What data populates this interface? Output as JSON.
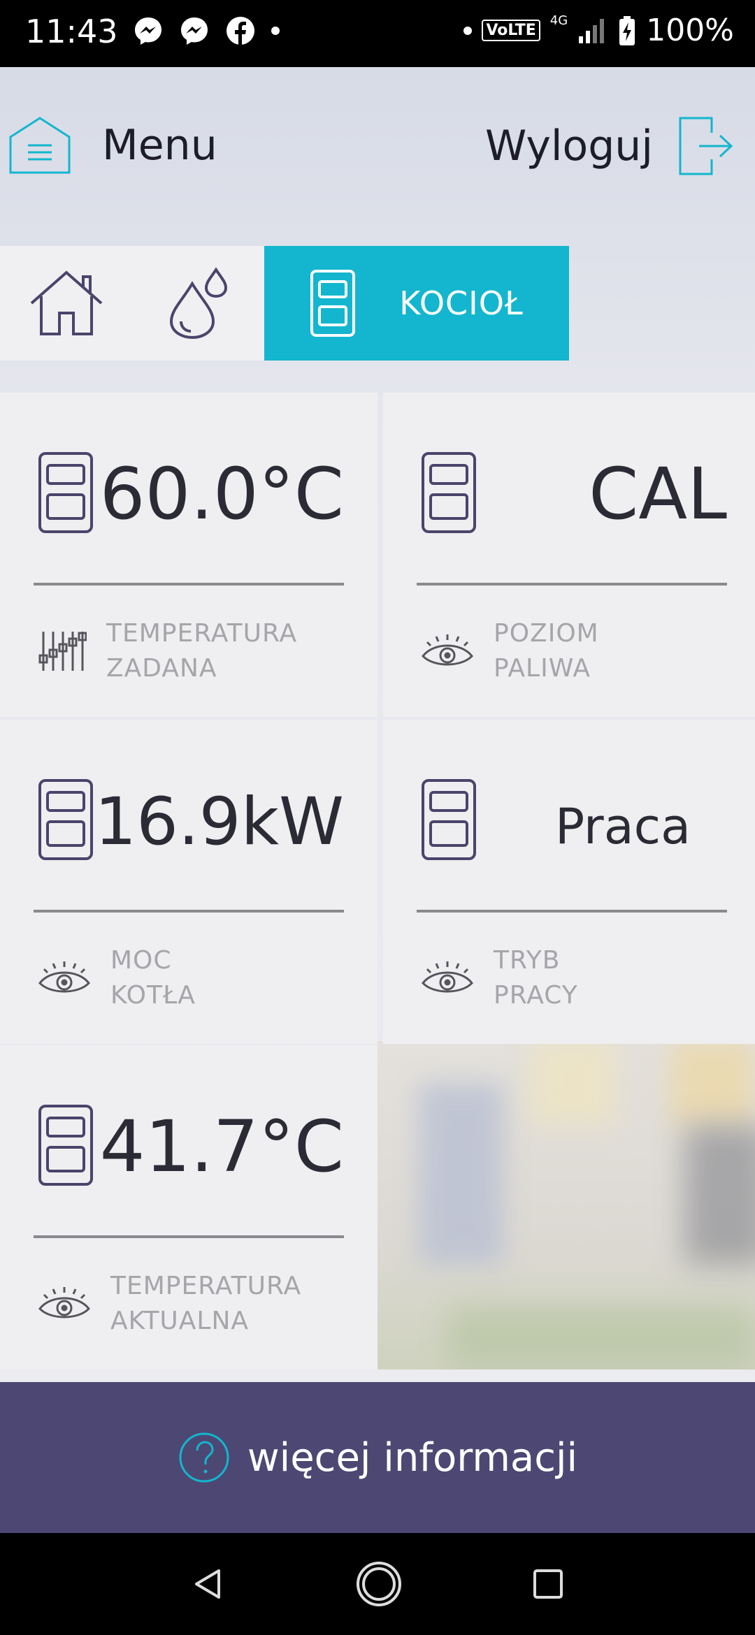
{
  "status_bar": {
    "time": "11:43",
    "left_icons": [
      "messenger-icon",
      "messenger-icon",
      "facebook-icon",
      "dot-icon"
    ],
    "volte": "VoLTE",
    "network": "4G",
    "battery": "100%"
  },
  "header": {
    "menu_label": "Menu",
    "logout_label": "Wyloguj"
  },
  "tabs": [
    {
      "icon": "home-icon",
      "label": "",
      "active": false
    },
    {
      "icon": "water-drops-icon",
      "label": "",
      "active": false
    },
    {
      "icon": "boiler-icon",
      "label": "KOCIOŁ",
      "active": true
    }
  ],
  "cards": [
    {
      "value": "60.0°C",
      "label_line1": "TEMPERATURA",
      "label_line2": "ZADANA",
      "label_icon": "sliders-icon"
    },
    {
      "value": "CAL",
      "label_line1": "POZIOM",
      "label_line2": "PALIWA",
      "label_icon": "eye-icon"
    },
    {
      "value": "16.9kW",
      "label_line1": "MOC",
      "label_line2": "KOTŁA",
      "label_icon": "eye-icon"
    },
    {
      "value": "Praca",
      "label_line1": "TRYB",
      "label_line2": "PRACY",
      "label_icon": "eye-icon"
    },
    {
      "value": "41.7°C",
      "label_line1": "TEMPERATURA",
      "label_line2": "AKTUALNA",
      "label_icon": "eye-icon"
    }
  ],
  "footer": {
    "info_label": "więcej informacji"
  },
  "colors": {
    "accent": "#13b6ce",
    "footer_bg": "#4c4873",
    "card_bg": "#efeff1",
    "icon_stroke": "#4a456b"
  }
}
